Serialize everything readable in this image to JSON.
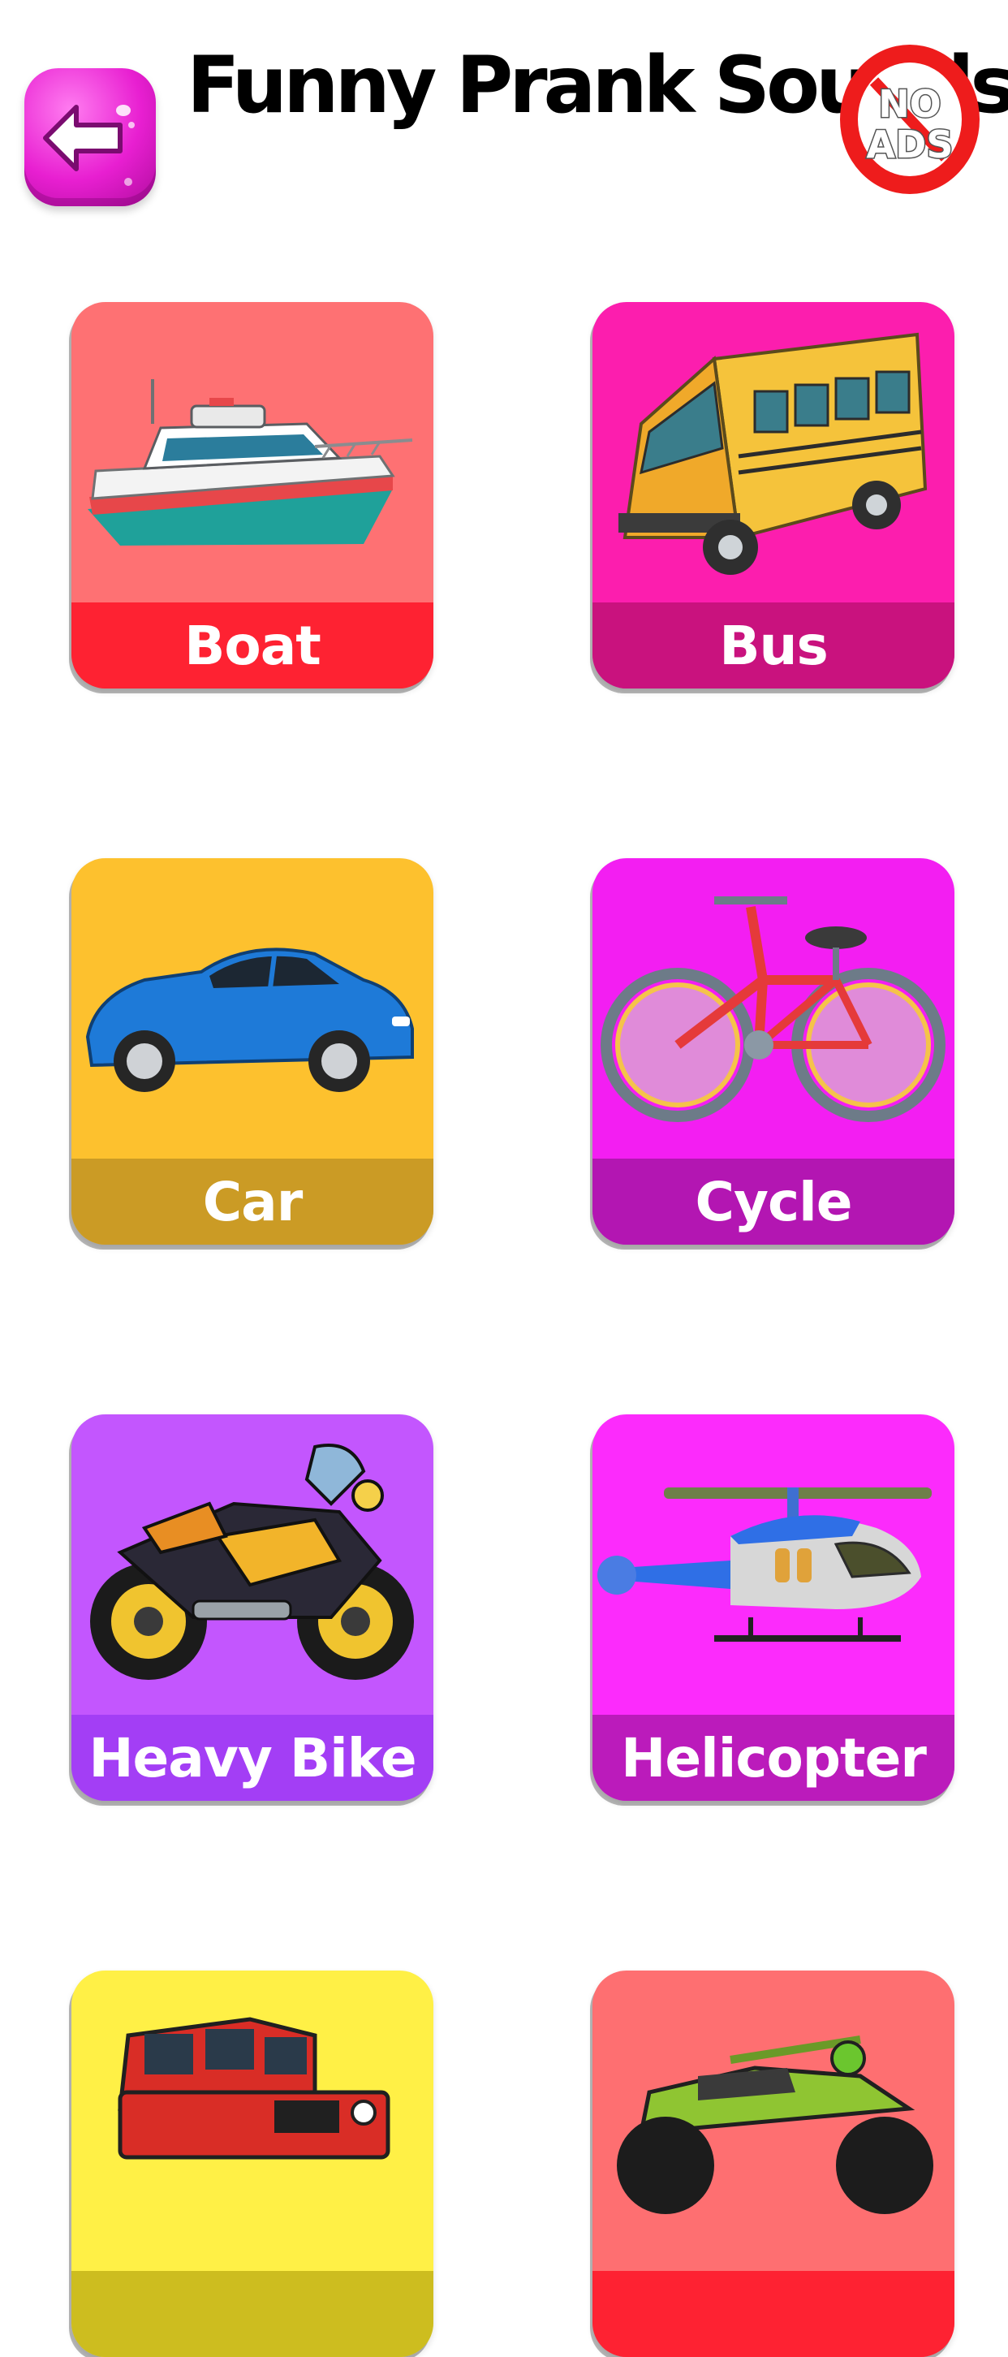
{
  "header": {
    "title": "Funny Prank Sounds",
    "back_icon": "back-arrow-icon",
    "no_ads": {
      "line1": "NO",
      "line2": "ADS"
    }
  },
  "colors": {
    "back_button": "#e81fd1",
    "no_ads_ring": "#f01f1f"
  },
  "cards": [
    {
      "label": "Boat",
      "icon": "boat-icon",
      "bg": "#fe7173",
      "bar": "#fe2232"
    },
    {
      "label": "Bus",
      "icon": "bus-icon",
      "bg": "#fc1eae",
      "bar": "#c9127e"
    },
    {
      "label": "Car",
      "icon": "car-icon",
      "bg": "#fdc12e",
      "bar": "#cb9b25"
    },
    {
      "label": "Cycle",
      "icon": "bicycle-icon",
      "bg": "#f31ef2",
      "bar": "#b316b2"
    },
    {
      "label": "Heavy Bike",
      "icon": "motorcycle-icon",
      "bg": "#c356fe",
      "bar": "#a33ef5"
    },
    {
      "label": "Helicopter",
      "icon": "helicopter-icon",
      "bg": "#fc2bfc",
      "bar": "#bb1bbb"
    },
    {
      "label": "",
      "icon": "jeep-icon",
      "bg": "#fff046",
      "bar": "#cdbd1f"
    },
    {
      "label": "",
      "icon": "dirt-bike-icon",
      "bg": "#fe6f71",
      "bar": "#fe2232"
    }
  ]
}
